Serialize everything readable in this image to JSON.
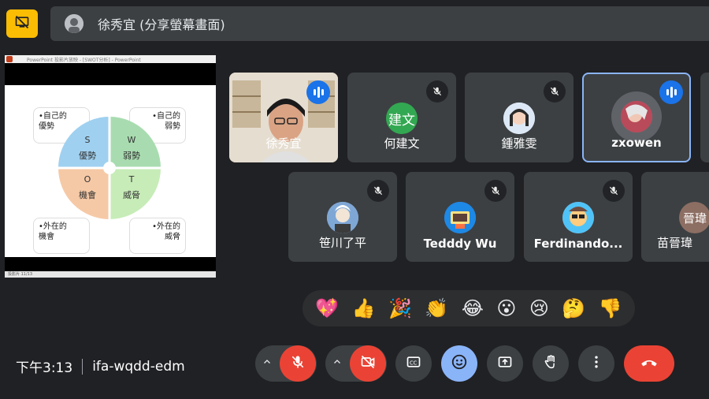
{
  "presenting": {
    "label": "徐秀宜 (分享螢幕畫面)"
  },
  "slide": {
    "window_title": "PowerPoint 投影片放映 - [SWOT分析] - PowerPoint",
    "status_text": "投影片 11/13",
    "boxes": {
      "top_left": "•自己的\n優勢",
      "top_right": "•自己的\n弱勢",
      "bottom_left": "•外在的\n機會",
      "bottom_right": "•外在的\n威脅"
    },
    "quadrants": {
      "s": "S\n優勢",
      "w": "W\n弱勢",
      "o": "O\n機會",
      "t": "T\n威脅"
    },
    "colors": {
      "s": "#9fd0f0",
      "w": "#a8dcb0",
      "o": "#f6c9a6",
      "t": "#c7ecb8"
    }
  },
  "participants": [
    {
      "name": "徐秀宜",
      "status": "speaking",
      "type": "video"
    },
    {
      "name": "何建文",
      "status": "muted",
      "avatar_text": "建文",
      "avatar_color": "#33a852"
    },
    {
      "name": "鍾雅雯",
      "status": "muted",
      "avatar_text": "",
      "avatar_color": "#8ab4f8"
    },
    {
      "name": "zxowen",
      "status": "speaking",
      "avatar_text": "",
      "avatar_color": "#d96a73"
    },
    {
      "name": "笹川了平",
      "status": "muted",
      "avatar_text": "",
      "avatar_color": "#a8c7fa"
    },
    {
      "name": "Tedddy Wu",
      "status": "muted",
      "avatar_text": "",
      "avatar_color": "#4285f4"
    },
    {
      "name": "Ferdinando...",
      "status": "muted",
      "avatar_text": "",
      "avatar_color": "#f28b82"
    },
    {
      "name": "苗晉瑋",
      "status": "muted",
      "avatar_text": "晉瑋",
      "avatar_color": "#8d6e63"
    }
  ],
  "reactions": [
    "💖",
    "👍",
    "🎉",
    "👏",
    "😂",
    "😮",
    "😢",
    "🤔",
    "👎"
  ],
  "footer": {
    "time": "下午3:13",
    "meeting_code": "ifa-wqdd-edm"
  },
  "controls": {
    "accent_red": "#ea4335",
    "accent_blue": "#8ab4f8"
  }
}
